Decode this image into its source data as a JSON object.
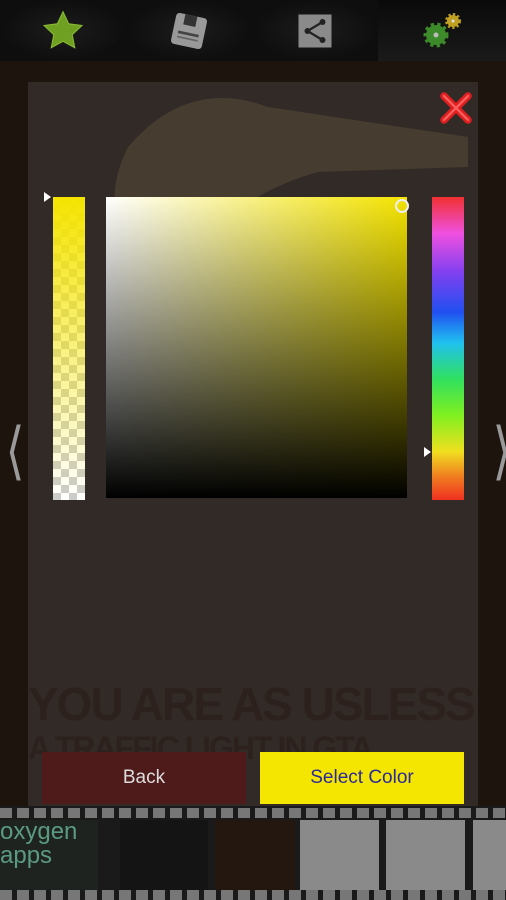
{
  "toolbar": {
    "tabs": [
      {
        "icon": "star-icon"
      },
      {
        "icon": "save-icon"
      },
      {
        "icon": "share-icon"
      },
      {
        "icon": "settings-gears-icon",
        "active": true
      }
    ]
  },
  "dialog": {
    "background_text_line1": "YOU ARE AS USLESS AS",
    "background_text_line2": "A TRAFFIC LIGHT IN GTA",
    "selected_color": "#f5e600",
    "hue_position": 0.84,
    "alpha": 1.0,
    "back_label": "Back",
    "select_label": "Select Color"
  },
  "filmstrip": {
    "first_thumb_text": "oxygen apps"
  }
}
